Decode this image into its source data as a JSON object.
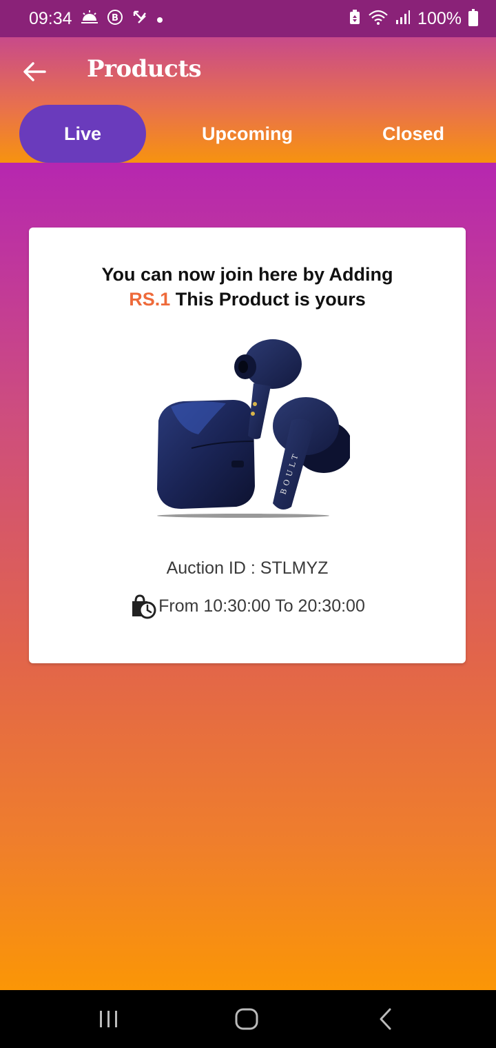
{
  "status_bar": {
    "time": "09:34",
    "battery": "100%",
    "icons": [
      "weather-icon",
      "b-icon",
      "missed-call-icon",
      "dot-icon",
      "battery-saver-icon",
      "wifi-icon",
      "signal-icon",
      "battery-icon"
    ]
  },
  "header": {
    "title": "Products",
    "back_icon": "arrow-left-icon"
  },
  "tabs": [
    {
      "label": "Live",
      "active": true
    },
    {
      "label": "Upcoming",
      "active": false
    },
    {
      "label": "Closed",
      "active": false
    }
  ],
  "card": {
    "headline_line1": "You can now join here by Adding",
    "price": "RS.1",
    "headline_line2_rest": " This Product is yours",
    "product_image": "earbuds-image",
    "product_image_brand": "BOULT",
    "auction_id_text": "Auction ID : STLMYZ",
    "time_text": "From 10:30:00 To 20:30:00"
  },
  "nav_bar": {
    "items": [
      "recent-apps-icon",
      "home-icon",
      "back-icon"
    ]
  },
  "colors": {
    "status_bar": "#8a2278",
    "active_tab": "#6a3bbc",
    "price_accent": "#ee6a3a",
    "gradient_top": "#b627b0",
    "gradient_bottom": "#fb9606"
  }
}
